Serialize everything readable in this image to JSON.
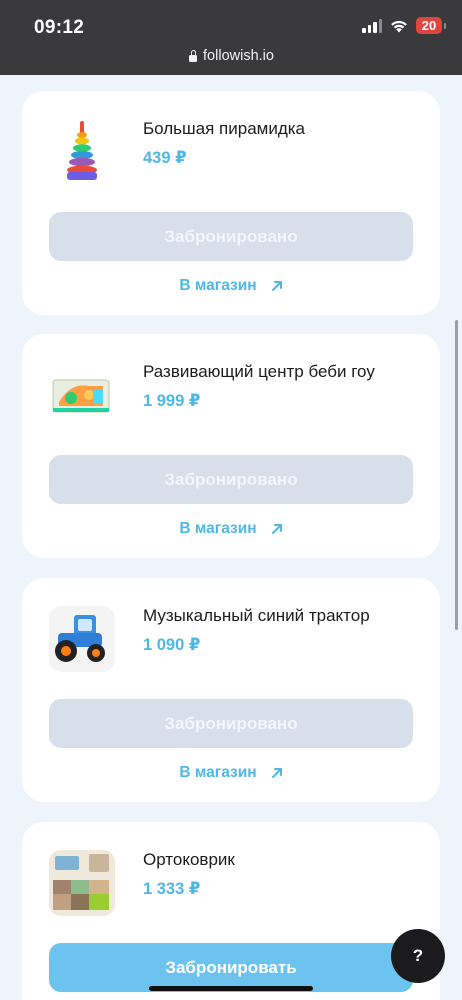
{
  "status_bar": {
    "time": "09:12",
    "battery": "20",
    "icons": [
      "signal-icon",
      "wifi-icon",
      "battery-icon"
    ]
  },
  "browser": {
    "url": "followish.io"
  },
  "items": [
    {
      "title": "Большая пирамидка",
      "price": "439 ₽",
      "button_label": "Забронировано",
      "button_state": "reserved",
      "shop_link": "В магазин"
    },
    {
      "title": "Развивающий центр беби гоу",
      "price": "1 999 ₽",
      "button_label": "Забронировано",
      "button_state": "reserved",
      "shop_link": "В магазин"
    },
    {
      "title": "Музыкальный синий трактор",
      "price": "1 090 ₽",
      "button_label": "Забронировано",
      "button_state": "reserved",
      "shop_link": "В магазин"
    },
    {
      "title": "Ортоковрик",
      "price": "1 333 ₽",
      "button_label": "Забронировать",
      "button_state": "available"
    }
  ],
  "help_button": "?",
  "colors": {
    "accent": "#4fb7e7",
    "reserved_button": "#d6dfea",
    "active_button": "#6cc3ef",
    "page_background": "#eef4fb"
  }
}
